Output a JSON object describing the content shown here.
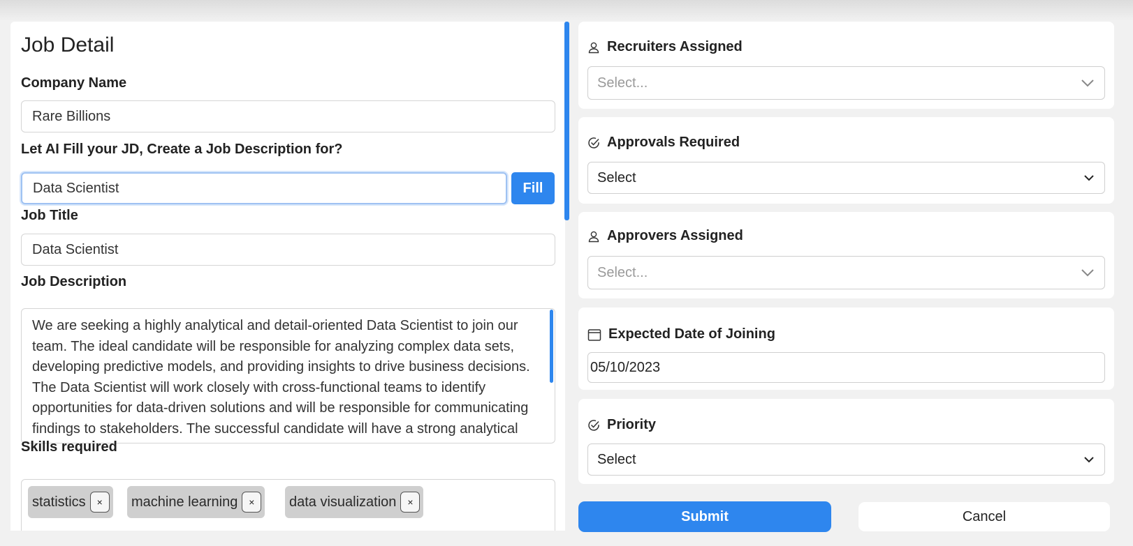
{
  "job_detail": {
    "heading": "Job Detail",
    "company_name_label": "Company Name",
    "company_name_value": "Rare Billions",
    "ai_fill_label": "Let AI Fill your JD, Create a Job Description for?",
    "ai_fill_value": "Data Scientist",
    "fill_button": "Fill",
    "job_title_label": "Job Title",
    "job_title_value": "Data Scientist",
    "job_description_label": "Job Description",
    "job_description_value": "We are seeking a highly analytical and detail-oriented Data Scientist to join our team. The ideal candidate will be responsible for analyzing complex data sets, developing predictive models, and providing insights to drive business decisions. The Data Scientist will work closely with cross-functional teams to identify opportunities for data-driven solutions and will be responsible for communicating findings to stakeholders. The successful candidate will have a strong analytical background and the ability to",
    "skills_label": "Skills required",
    "skills": [
      "statistics",
      "machine learning",
      "data visualization"
    ],
    "chip_remove": "×"
  },
  "sidebar": {
    "recruiters_label": "Recruiters Assigned",
    "recruiters_placeholder": "Select...",
    "approvals_label": "Approvals Required",
    "approvals_value": "Select",
    "approvers_label": "Approvers Assigned",
    "approvers_placeholder": "Select...",
    "doj_label": "Expected Date of Joining",
    "doj_value": "05/10/2023",
    "priority_label": "Priority",
    "priority_value": "Select"
  },
  "actions": {
    "submit": "Submit",
    "cancel": "Cancel"
  },
  "colors": {
    "accent": "#2e86ee",
    "chip_bg": "#cfcfcf"
  }
}
